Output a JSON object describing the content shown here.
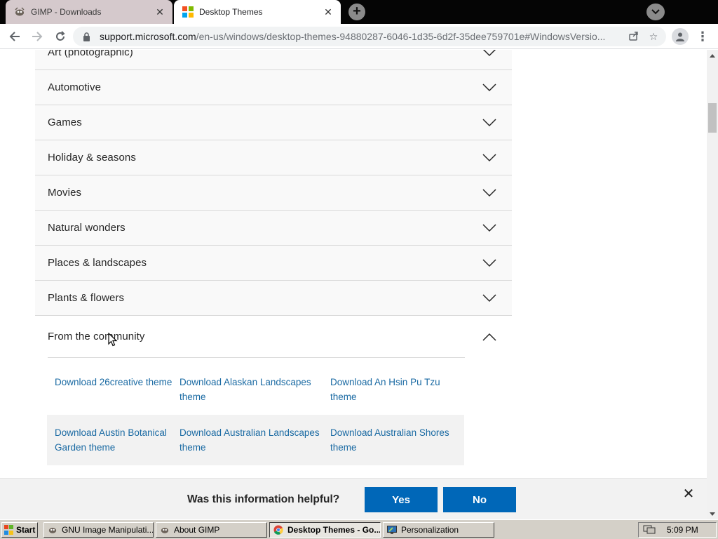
{
  "browser": {
    "tabs": [
      {
        "title": "GIMP - Downloads",
        "active": false
      },
      {
        "title": "Desktop Themes",
        "active": true
      }
    ],
    "url": {
      "host": "support.microsoft.com",
      "path": "/en-us/windows/desktop-themes-94880287-6046-1d35-6d2f-35dee759701e#WindowsVersio..."
    }
  },
  "accordion": {
    "items": [
      {
        "label": "Art (photographic)",
        "open": false
      },
      {
        "label": "Automotive",
        "open": false
      },
      {
        "label": "Games",
        "open": false
      },
      {
        "label": "Holiday & seasons",
        "open": false
      },
      {
        "label": "Movies",
        "open": false
      },
      {
        "label": "Natural wonders",
        "open": false
      },
      {
        "label": "Places & landscapes",
        "open": false
      },
      {
        "label": "Plants & flowers",
        "open": false
      },
      {
        "label": "From the community",
        "open": true
      }
    ]
  },
  "community_themes": {
    "rows": [
      [
        "Download 26creative theme",
        "Download Alaskan Landscapes theme",
        "Download An Hsin Pu Tzu theme"
      ],
      [
        "Download Austin Botanical Garden theme",
        "Download Australian Landscapes theme",
        "Download Australian Shores theme"
      ]
    ]
  },
  "feedback": {
    "question": "Was this information helpful?",
    "yes_label": "Yes",
    "no_label": "No"
  },
  "taskbar": {
    "start_label": "Start",
    "windows": [
      {
        "label": "GNU Image Manipulati...",
        "icon": "gimp-icon",
        "active": false
      },
      {
        "label": "About GIMP",
        "icon": "gimp-icon",
        "active": false
      },
      {
        "label": "Desktop Themes - Go...",
        "icon": "chrome-icon",
        "active": true
      },
      {
        "label": "Personalization",
        "icon": "personalization-icon",
        "active": false
      }
    ],
    "clock": "5:09 PM"
  },
  "colors": {
    "link": "#1a6aa3",
    "button_blue": "#0067b8",
    "tabstrip": "#050505"
  }
}
